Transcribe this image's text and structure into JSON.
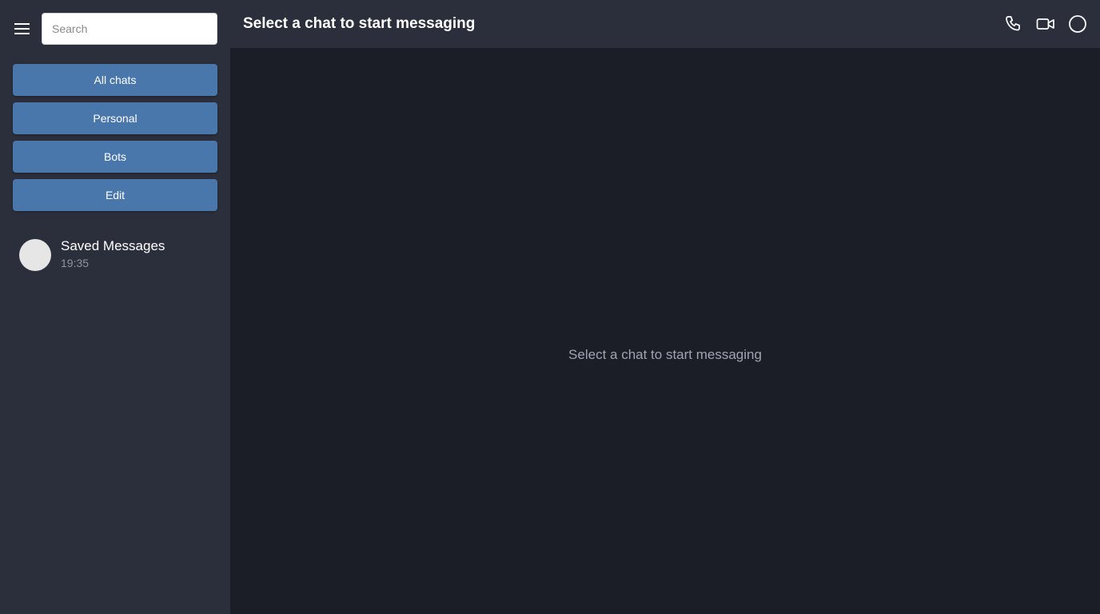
{
  "sidebar": {
    "menu_icon": "hamburger-menu-icon",
    "search": {
      "placeholder": "Search",
      "value": ""
    },
    "folders": [
      {
        "label": "All chats"
      },
      {
        "label": "Personal"
      },
      {
        "label": "Bots"
      },
      {
        "label": "Edit"
      }
    ],
    "chats": [
      {
        "name": "Saved Messages",
        "time": "19:35"
      }
    ]
  },
  "header": {
    "title": "Select a chat to start messaging",
    "actions": [
      "phone-icon",
      "video-camera-icon",
      "circle-icon"
    ]
  },
  "main": {
    "placeholder": "Select a chat to start messaging"
  },
  "colors": {
    "sidebar_bg": "#2b2f3b",
    "main_bg": "#1b1e27",
    "button_bg": "#4a77ab",
    "text_primary": "#ffffff",
    "text_muted": "#8e93a0"
  }
}
